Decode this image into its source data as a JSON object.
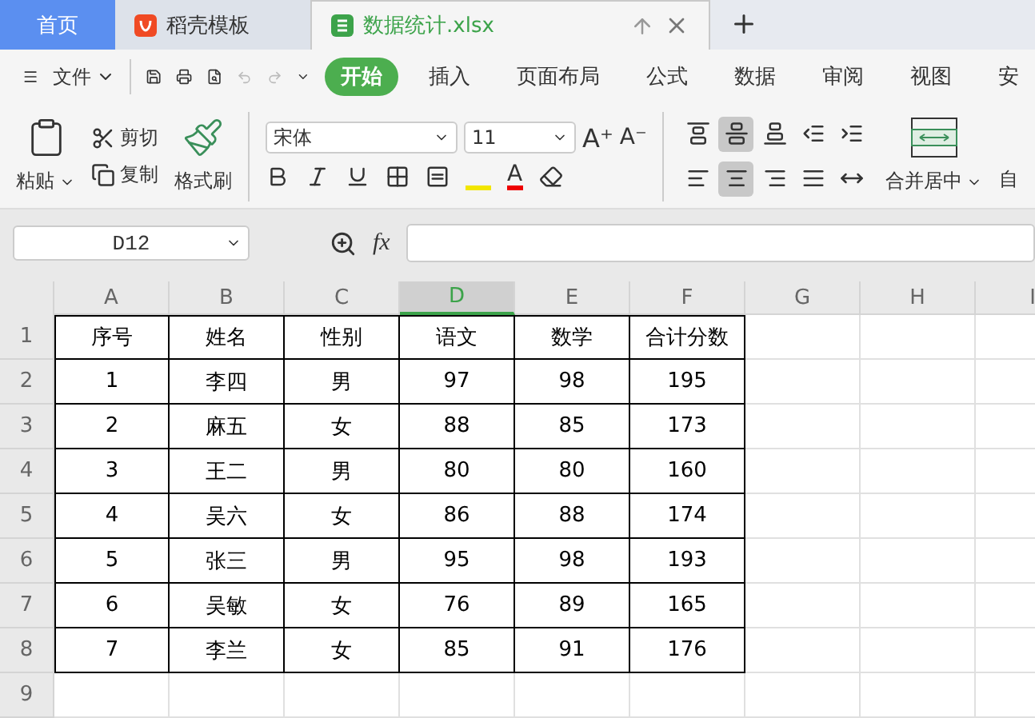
{
  "tabs": [
    {
      "label": "首页",
      "kind": "home",
      "selected": false
    },
    {
      "label": "稻壳模板",
      "kind": "docer",
      "selected": false
    },
    {
      "label": "数据统计.xlsx",
      "kind": "sheet",
      "selected": true
    }
  ],
  "menu": {
    "file": "文件",
    "tabs": [
      {
        "label": "开始",
        "selected": true
      },
      {
        "label": "插入",
        "selected": false
      },
      {
        "label": "页面布局",
        "selected": false
      },
      {
        "label": "公式",
        "selected": false
      },
      {
        "label": "数据",
        "selected": false
      },
      {
        "label": "审阅",
        "selected": false
      },
      {
        "label": "视图",
        "selected": false
      },
      {
        "label": "安",
        "selected": false
      }
    ]
  },
  "ribbon": {
    "paste": "粘贴",
    "cut": "剪切",
    "copy": "复制",
    "format_painter": "格式刷",
    "font": "宋体",
    "font_size": "11",
    "grow_font": "A⁺",
    "shrink_font": "A⁻",
    "font_color": "A",
    "merge": "合并居中",
    "cut_off": "自",
    "align_top": [
      {
        "kind": "top",
        "selected": false
      },
      {
        "kind": "middle",
        "selected": true
      },
      {
        "kind": "bottom",
        "selected": false
      },
      {
        "kind": "outdent",
        "selected": false
      },
      {
        "kind": "indent",
        "selected": false
      }
    ],
    "align_bottom": [
      {
        "kind": "left",
        "selected": false
      },
      {
        "kind": "center",
        "selected": true
      },
      {
        "kind": "right",
        "selected": false
      },
      {
        "kind": "justify",
        "selected": false
      },
      {
        "kind": "distribute",
        "selected": false
      }
    ]
  },
  "formula_bar": {
    "name_box": "D12",
    "fx": "fx"
  },
  "sheet": {
    "columns": [
      {
        "label": "A",
        "selected": false
      },
      {
        "label": "B",
        "selected": false
      },
      {
        "label": "C",
        "selected": false
      },
      {
        "label": "D",
        "selected": true
      },
      {
        "label": "E",
        "selected": false
      },
      {
        "label": "F",
        "selected": false
      },
      {
        "label": "G",
        "selected": false
      },
      {
        "label": "H",
        "selected": false
      },
      {
        "label": "I",
        "selected": false
      }
    ],
    "rows": [
      {
        "label": "1",
        "cells": [
          "序号",
          "姓名",
          "性别",
          "语文",
          "数学",
          "合计分数"
        ]
      },
      {
        "label": "2",
        "cells": [
          "1",
          "李四",
          "男",
          "97",
          "98",
          "195"
        ]
      },
      {
        "label": "3",
        "cells": [
          "2",
          "麻五",
          "女",
          "88",
          "85",
          "173"
        ]
      },
      {
        "label": "4",
        "cells": [
          "3",
          "王二",
          "男",
          "80",
          "80",
          "160"
        ]
      },
      {
        "label": "5",
        "cells": [
          "4",
          "吴六",
          "女",
          "86",
          "88",
          "174"
        ]
      },
      {
        "label": "6",
        "cells": [
          "5",
          "张三",
          "男",
          "95",
          "98",
          "193"
        ]
      },
      {
        "label": "7",
        "cells": [
          "6",
          "吴敏",
          "女",
          "76",
          "89",
          "165"
        ]
      },
      {
        "label": "8",
        "cells": [
          "7",
          "李兰",
          "女",
          "85",
          "91",
          "176"
        ]
      },
      {
        "label": "9",
        "cells": []
      }
    ]
  }
}
